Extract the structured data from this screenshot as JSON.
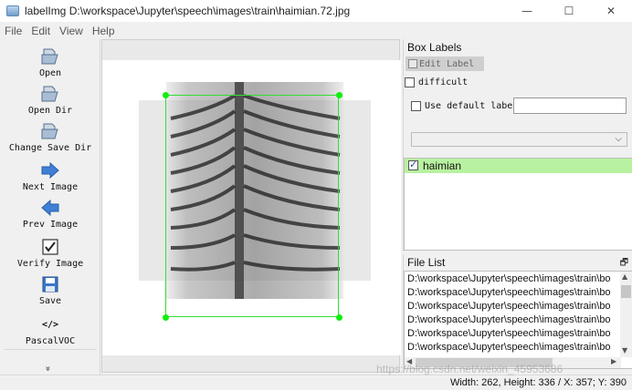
{
  "window": {
    "title": "labelImg D:\\workspace\\Jupyter\\speech\\images\\train\\haimian.72.jpg",
    "controls": {
      "minimize": "—",
      "maximize": "☐",
      "close": "✕"
    }
  },
  "menu": [
    "File",
    "Edit",
    "View",
    "Help"
  ],
  "toolbar": {
    "open": "Open",
    "open_dir": "Open Dir",
    "change_save_dir": "Change Save Dir",
    "next_image": "Next Image",
    "prev_image": "Prev Image",
    "verify_image": "Verify Image",
    "save": "Save",
    "pascalvoc_icon": "</>",
    "pascalvoc": "PascalVOC",
    "more": "»"
  },
  "box_labels": {
    "title": "Box Labels",
    "edit_label": "Edit Label",
    "difficult": "difficult",
    "use_default_label": "Use default label",
    "default_label_value": "",
    "labels": [
      {
        "name": "haimian",
        "checked": true
      }
    ]
  },
  "file_list": {
    "title": "File List",
    "float_icon": "🗗",
    "items": [
      "D:\\workspace\\Jupyter\\speech\\images\\train\\bo",
      "D:\\workspace\\Jupyter\\speech\\images\\train\\bo",
      "D:\\workspace\\Jupyter\\speech\\images\\train\\bo",
      "D:\\workspace\\Jupyter\\speech\\images\\train\\bo",
      "D:\\workspace\\Jupyter\\speech\\images\\train\\bo",
      "D:\\workspace\\Jupyter\\speech\\images\\train\\bo"
    ]
  },
  "status": "Width: 262, Height: 336 / X: 357; Y: 390",
  "watermark": "https://blog.csdn.net/weixin_45953686",
  "colors": {
    "bbox": "#33dd33",
    "selected_label": "#b8f2a0"
  }
}
